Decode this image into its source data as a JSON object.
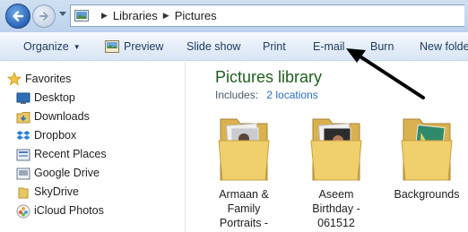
{
  "address_bar": {
    "crumbs": [
      "Libraries",
      "Pictures"
    ]
  },
  "toolbar": {
    "organize": "Organize",
    "preview": "Preview",
    "slideshow": "Slide show",
    "print": "Print",
    "email": "E-mail",
    "burn": "Burn",
    "new_folder": "New folde"
  },
  "nav_pane": {
    "favorites": "Favorites",
    "items": [
      {
        "label": "Desktop",
        "icon": "desktop-icon"
      },
      {
        "label": "Downloads",
        "icon": "downloads-folder-icon"
      },
      {
        "label": "Dropbox",
        "icon": "dropbox-icon"
      },
      {
        "label": "Recent Places",
        "icon": "recent-places-icon"
      },
      {
        "label": "Google Drive",
        "icon": "google-drive-icon"
      },
      {
        "label": "SkyDrive",
        "icon": "skydrive-folder-icon"
      },
      {
        "label": "iCloud Photos",
        "icon": "icloud-photos-icon"
      }
    ]
  },
  "content": {
    "title": "Pictures library",
    "includes_label": "Includes:",
    "includes_link": "2 locations",
    "folders": [
      {
        "line1": "Armaan &",
        "line2": "Family",
        "line3": "Portraits -"
      },
      {
        "line1": "Aseem",
        "line2": "Birthday -",
        "line3": "061512"
      },
      {
        "line1": "Backgrounds",
        "line2": "",
        "line3": ""
      }
    ]
  },
  "colors": {
    "title_green": "#1e5e1e",
    "link_blue": "#2a6cc4",
    "toolbar_text": "#1e3a5f"
  }
}
